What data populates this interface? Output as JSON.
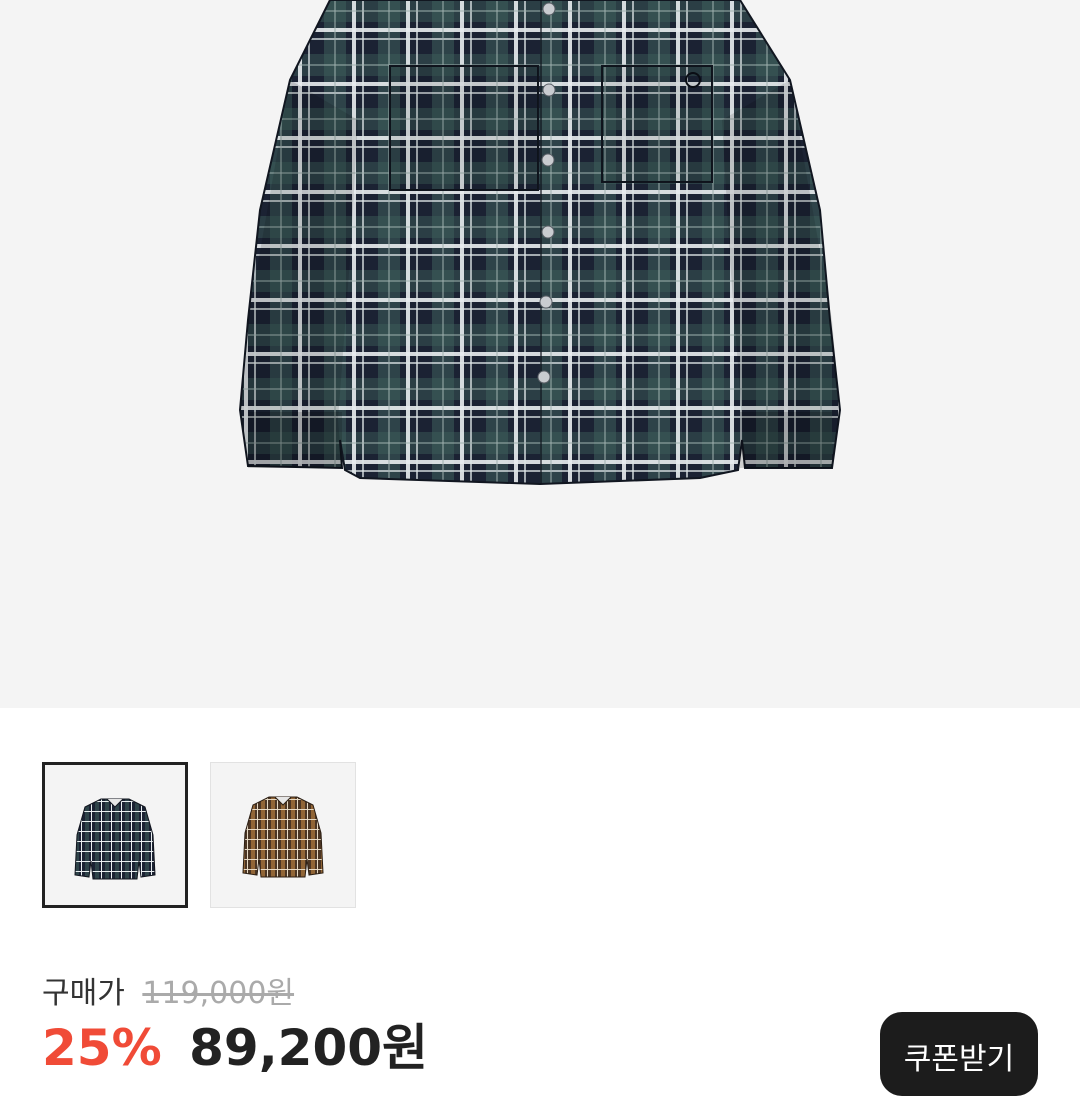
{
  "product": {
    "image": {
      "name": "navy-plaid-shirt-image",
      "pattern": "navy-green-white-plaid"
    },
    "colors": [
      {
        "name": "navy",
        "selected": true,
        "pattern_colors": [
          "#1b2233",
          "#ffffff",
          "#3e5f5a"
        ]
      },
      {
        "name": "brown",
        "selected": false,
        "pattern_colors": [
          "#4a3524",
          "#b07a3e",
          "#e6d9c4"
        ]
      }
    ]
  },
  "price": {
    "label": "구매가",
    "original": "119,000원",
    "discount_rate": "25%",
    "sale": "89,200원"
  },
  "coupon": {
    "label": "쿠폰받기"
  },
  "theme": {
    "accent": "#f04b37",
    "dark": "#1c1c1c",
    "hero_bg": "#f4f4f4"
  }
}
